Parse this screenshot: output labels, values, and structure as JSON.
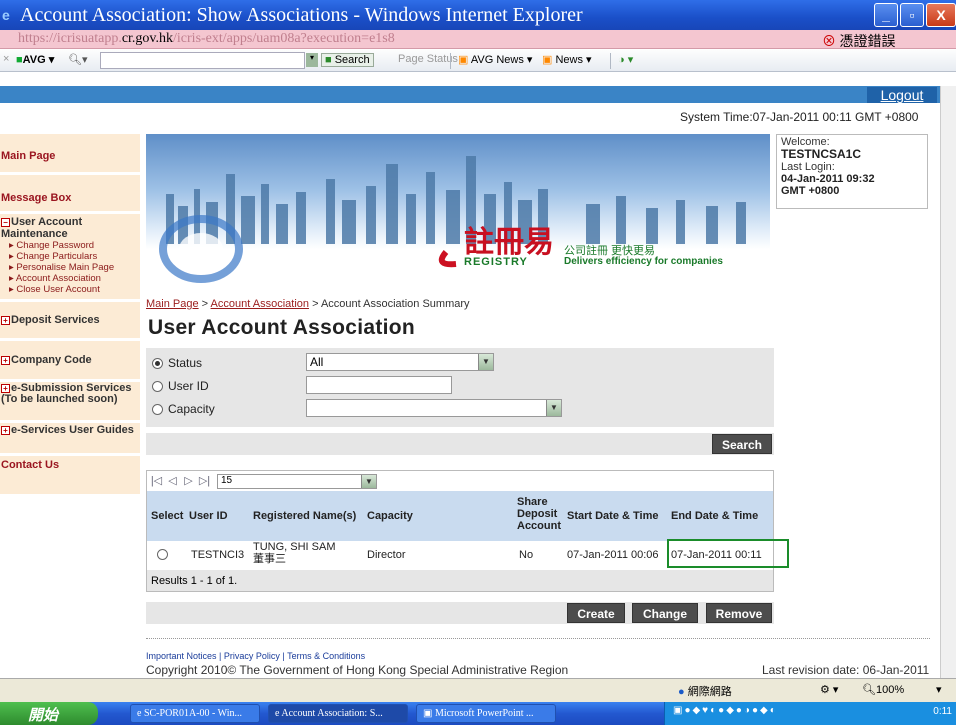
{
  "window": {
    "title": "Account Association: Show Associations - Windows Internet Explorer"
  },
  "address": {
    "prefix": "https://icrisuatapp.",
    "domain": "cr.gov.hk",
    "suffix": "/icris-ext/apps/uam08a?execution=e1s8",
    "cert_error": "憑證錯誤"
  },
  "toolbar": {
    "avg_label": "AVG",
    "search_button": "Search",
    "page_status": "Page Status",
    "avg_news": "AVG News",
    "news": "News"
  },
  "header": {
    "logout": "Logout",
    "system_time": "System Time:07-Jan-2011 00:11 GMT +0800"
  },
  "welcome": {
    "label": "Welcome:",
    "user": "TESTNCSA1C",
    "last_login_label": "Last Login:",
    "last_login_date": "04-Jan-2011 09:32",
    "last_login_tz": "GMT +0800"
  },
  "nav": {
    "main_page": "Main Page",
    "message_box": "Message Box",
    "user_account": "User Account Maintenance",
    "user_account_items": [
      "Change Password",
      "Change Particulars",
      "Personalise Main Page",
      "Account Association",
      "Close User Account"
    ],
    "deposit": "Deposit Services",
    "company_code": "Company Code",
    "esubmission": "e-Submission Services (To be launched soon)",
    "eservices": "e-Services User Guides",
    "contact": "Contact Us"
  },
  "hero": {
    "logo_cn": "註冊易",
    "logo_en": "REGISTRY",
    "tag_cn": "公司註冊 更快更易",
    "tag_en": "Delivers efficiency for companies"
  },
  "breadcrumb": {
    "home": "Main Page",
    "level2": "Account Association",
    "current": "Account Association Summary",
    "sep": ">"
  },
  "page": {
    "title": "User Account Association"
  },
  "filter": {
    "status_label": "Status",
    "status_value": "All",
    "userid_label": "User ID",
    "userid_value": "",
    "capacity_label": "Capacity",
    "capacity_value": "",
    "search_button": "Search"
  },
  "table": {
    "page_size": "15",
    "columns": [
      "Select",
      "User ID",
      "Registered Name(s)",
      "Capacity",
      "Share Deposit Account",
      "Start Date & Time",
      "End Date & Time"
    ],
    "rows": [
      {
        "user_id": "TESTNCI3",
        "name_en": "TUNG, SHI SAM",
        "name_cn": "董事三",
        "capacity": "Director",
        "share": "No",
        "start": "07-Jan-2011 00:06",
        "end": "07-Jan-2011 00:11"
      }
    ],
    "results": "Results 1 - 1 of 1."
  },
  "actions": {
    "create": "Create",
    "change": "Change",
    "remove": "Remove"
  },
  "footer": {
    "important": "Important Notices",
    "privacy": "Privacy Policy",
    "terms": "Terms & Conditions",
    "copyright": "Copyright 2010© The Government of Hong Kong Special Administrative Region",
    "last_revision": "Last revision date: 06-Jan-2011"
  },
  "statusbar": {
    "zone": "網際網路",
    "zoom": "100%"
  },
  "taskbar": {
    "start": "開始",
    "tasks": [
      "SC-POR01A-00 - Win...",
      "Account Association: S...",
      "Microsoft PowerPoint ..."
    ],
    "clock": "0:11"
  }
}
